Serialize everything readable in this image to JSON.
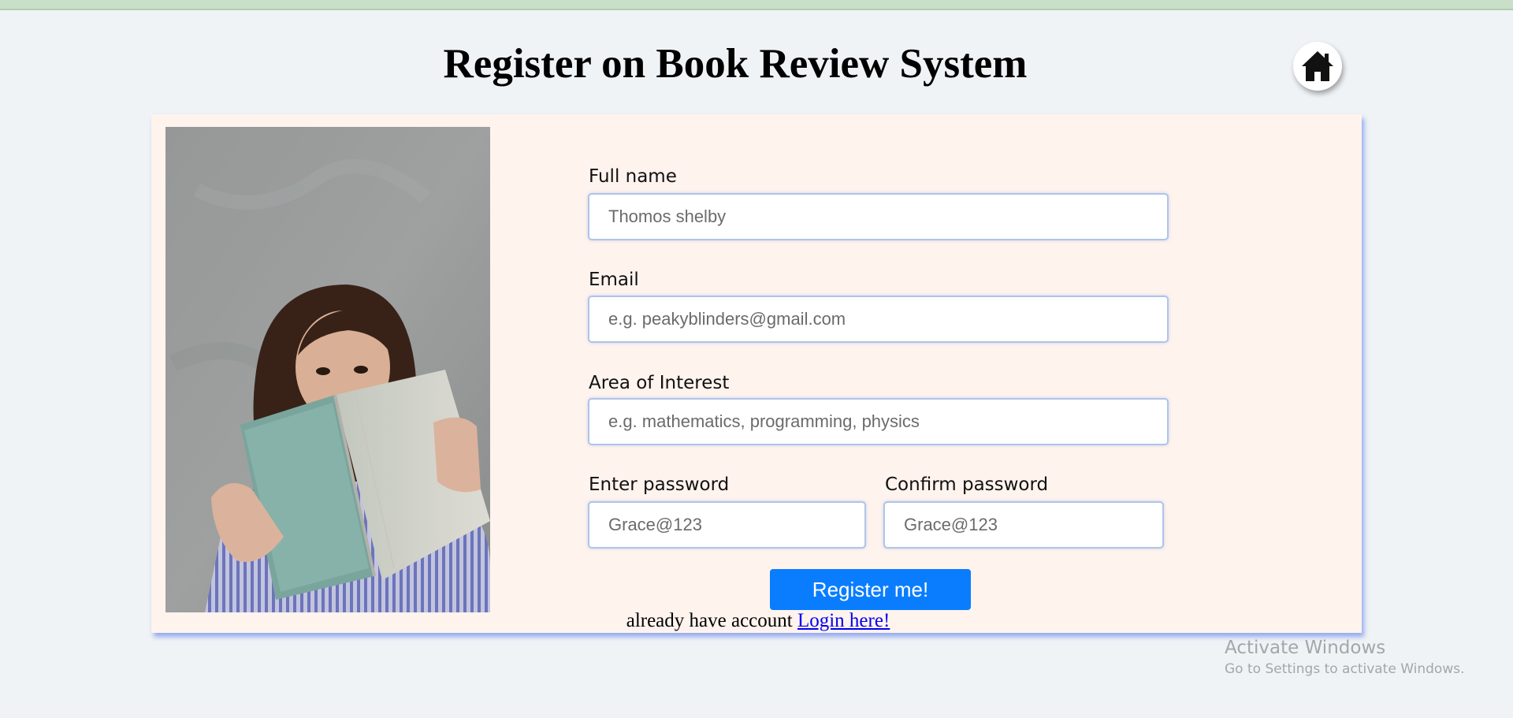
{
  "header": {
    "title": "Register on Book Review System",
    "home_icon": "home-icon"
  },
  "form": {
    "full_name": {
      "label": "Full name",
      "placeholder": "Thomos shelby"
    },
    "email": {
      "label": "Email",
      "placeholder": "e.g. peakyblinders@gmail.com"
    },
    "interest": {
      "label": "Area of Interest",
      "placeholder": "e.g. mathematics, programming, physics"
    },
    "password": {
      "label": "Enter password",
      "placeholder": "Grace@123"
    },
    "confirm_password": {
      "label": "Confirm password",
      "placeholder": "Grace@123"
    },
    "submit_label": "Register me!",
    "login_prompt": "already have account",
    "login_link": "Login here!"
  },
  "watermark": {
    "title": "Activate Windows",
    "subtitle": "Go to Settings to activate Windows."
  },
  "colors": {
    "page_background": "#f0f3f6",
    "card_background": "#fff3ee",
    "primary_button": "#0a7dff",
    "link": "#0000ee",
    "top_strip": "#c8e0c8"
  }
}
